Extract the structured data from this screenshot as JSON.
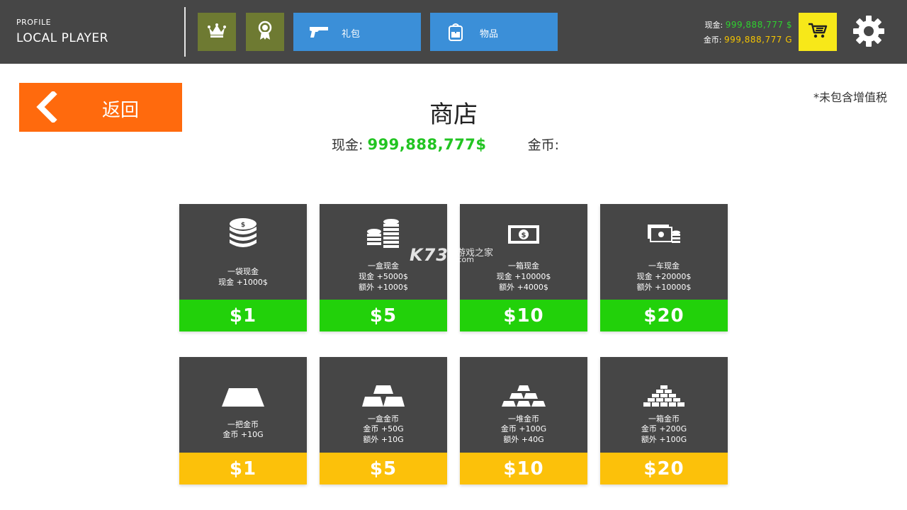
{
  "header": {
    "profile_label": "PROFILE",
    "player_name": "LOCAL PLAYER",
    "nav": {
      "crown_icon": "crown-icon",
      "badge_icon": "award-badge-icon",
      "gift_label": "礼包",
      "gift_icon": "pistol-icon",
      "items_label": "物品",
      "items_icon": "backpack-icon"
    },
    "cash_label": "现金:",
    "cash_value": "999,888,777 $",
    "gold_label": "金币:",
    "gold_value": "999,888,777 G",
    "cart_icon": "cart-icon",
    "settings_icon": "gear-icon"
  },
  "back_button": {
    "label": "返回",
    "icon": "chevron-left-icon"
  },
  "tax_note": "*未包含增值税",
  "shop": {
    "title": "商店",
    "cash_label": "现金:",
    "cash_value": "999,888,777$",
    "gold_label": "金币:"
  },
  "cash_packs": [
    {
      "icon": "coin-stack-icon",
      "name": "一袋现金",
      "line1": "现金 +1000$",
      "line2": "",
      "price": "$1"
    },
    {
      "icon": "coin-stacks-icon",
      "name": "一盒现金",
      "line1": "现金 +5000$",
      "line2": "额外 +1000$",
      "price": "$5"
    },
    {
      "icon": "banknote-icon",
      "name": "一箱现金",
      "line1": "现金 +10000$",
      "line2": "额外 +4000$",
      "price": "$10"
    },
    {
      "icon": "banknotes-coins-icon",
      "name": "一车现金",
      "line1": "现金 +20000$",
      "line2": "额外 +10000$",
      "price": "$20"
    }
  ],
  "gold_packs": [
    {
      "icon": "gold-bar-icon",
      "name": "一把金币",
      "line1": "金币 +10G",
      "line2": "",
      "price": "$1"
    },
    {
      "icon": "gold-bars-icon",
      "name": "一盒金币",
      "line1": "金币 +50G",
      "line2": "额外 +10G",
      "price": "$5"
    },
    {
      "icon": "gold-pile-icon",
      "name": "一堆金币",
      "line1": "金币 +100G",
      "line2": "额外 +40G",
      "price": "$10"
    },
    {
      "icon": "gold-pyramid-icon",
      "name": "一箱金币",
      "line1": "金币 +200G",
      "line2": "额外 +100G",
      "price": "$20"
    }
  ],
  "watermark": {
    "logo": "K73",
    "text": "游戏之家",
    "domain": ".com"
  },
  "colors": {
    "topbar": "#464646",
    "green_price": "#22d10a",
    "yellow_price": "#fcc10a",
    "back_orange": "#ff6a0d",
    "nav_blue": "#3b8fd8",
    "nav_olive": "#6e7a32",
    "cart_yellow": "#f7e819"
  }
}
